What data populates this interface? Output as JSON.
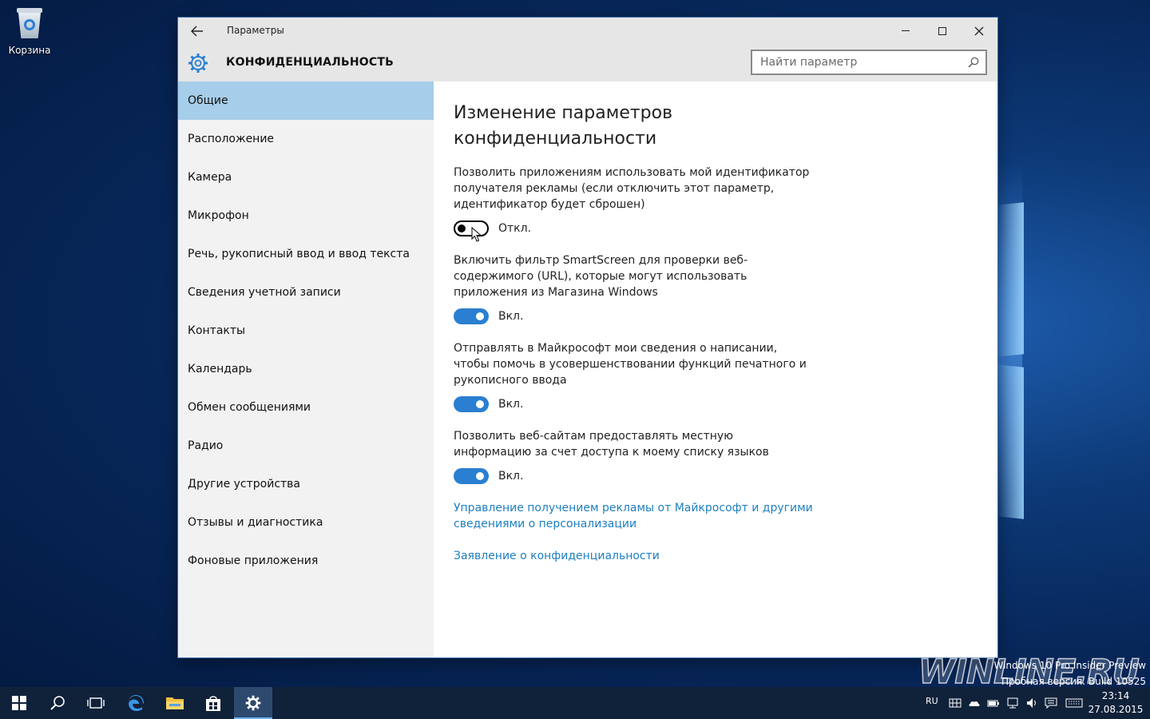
{
  "desktop": {
    "recycle_bin_label": "Корзина",
    "watermark_brand": "WINLINE.RU",
    "build_line1": "Windows 10 Pro Insider Preview",
    "build_line2": "Пробная версия. Build 10525"
  },
  "window": {
    "app_title": "Параметры",
    "section_title": "КОНФИДЕНЦИАЛЬНОСТЬ",
    "search_placeholder": "Найти параметр"
  },
  "sidebar": {
    "active_index": 0,
    "items": [
      {
        "label": "Общие"
      },
      {
        "label": "Расположение"
      },
      {
        "label": "Камера"
      },
      {
        "label": "Микрофон"
      },
      {
        "label": "Речь, рукописный ввод и ввод текста"
      },
      {
        "label": "Сведения учетной записи"
      },
      {
        "label": "Контакты"
      },
      {
        "label": "Календарь"
      },
      {
        "label": "Обмен сообщениями"
      },
      {
        "label": "Радио"
      },
      {
        "label": "Другие устройства"
      },
      {
        "label": "Отзывы и диагностика"
      },
      {
        "label": "Фоновые приложения"
      }
    ]
  },
  "content": {
    "heading": "Изменение параметров конфиденциальности",
    "settings": [
      {
        "description": "Позволить приложениям использовать мой идентификатор получателя рекламы (если отключить этот параметр, идентификатор будет сброшен)",
        "state": "off",
        "state_label": "Откл."
      },
      {
        "description": "Включить фильтр SmartScreen для проверки веб-содержимого (URL), которые могут использовать приложения из Магазина Windows",
        "state": "on",
        "state_label": "Вкл."
      },
      {
        "description": "Отправлять в Майкрософт мои сведения о написании, чтобы помочь в усовершенствовании функций печатного и рукописного ввода",
        "state": "on",
        "state_label": "Вкл."
      },
      {
        "description": "Позволить веб-сайтам предоставлять местную информацию за счет доступа к моему списку языков",
        "state": "on",
        "state_label": "Вкл."
      }
    ],
    "links": [
      {
        "label": "Управление получением рекламы от Майкрософт и другими сведениями о персонализации"
      },
      {
        "label": "Заявление о конфиденциальности"
      }
    ]
  },
  "taskbar": {
    "language": "RU",
    "time": "23:14",
    "date": "27.08.2015"
  },
  "colors": {
    "accent": "#2a7fd0",
    "sidebar_active": "#a6cde9",
    "link": "#1e7fc0",
    "taskbar": "#10213a"
  }
}
